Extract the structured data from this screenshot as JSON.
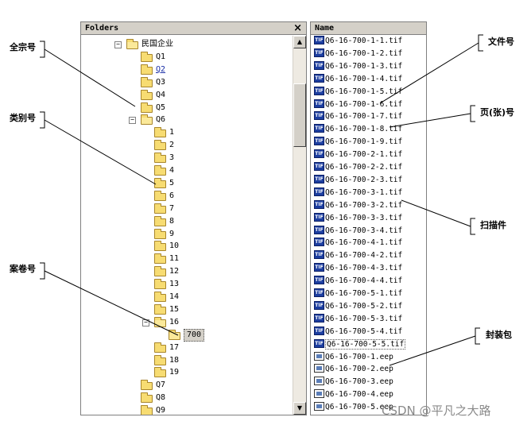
{
  "folders_pane": {
    "header": "Folders",
    "close_glyph": "×",
    "root_label": "民国企业",
    "q_items": [
      "Q1",
      "Q2",
      "Q3",
      "Q4",
      "Q5",
      "Q6"
    ],
    "q6_children": [
      "1",
      "2",
      "3",
      "4",
      "5",
      "6",
      "7",
      "8",
      "9",
      "10",
      "11",
      "12",
      "13",
      "14",
      "15",
      "16"
    ],
    "q16_child": "700",
    "after_16": [
      "17",
      "18",
      "19"
    ],
    "tail_items": [
      "Q7",
      "Q8",
      "Q9"
    ]
  },
  "files_pane": {
    "header": "Name",
    "tif_files": [
      "Q6-16-700-1-1.tif",
      "Q6-16-700-1-2.tif",
      "Q6-16-700-1-3.tif",
      "Q6-16-700-1-4.tif",
      "Q6-16-700-1-5.tif",
      "Q6-16-700-1-6.tif",
      "Q6-16-700-1-7.tif",
      "Q6-16-700-1-8.tif",
      "Q6-16-700-1-9.tif",
      "Q6-16-700-2-1.tif",
      "Q6-16-700-2-2.tif",
      "Q6-16-700-2-3.tif",
      "Q6-16-700-3-1.tif",
      "Q6-16-700-3-2.tif",
      "Q6-16-700-3-3.tif",
      "Q6-16-700-3-4.tif",
      "Q6-16-700-4-1.tif",
      "Q6-16-700-4-2.tif",
      "Q6-16-700-4-3.tif",
      "Q6-16-700-4-4.tif",
      "Q6-16-700-5-1.tif",
      "Q6-16-700-5-2.tif",
      "Q6-16-700-5-3.tif",
      "Q6-16-700-5-4.tif",
      "Q6-16-700-5-5.tif"
    ],
    "eep_files": [
      "Q6-16-700-1.eep",
      "Q6-16-700-2.eep",
      "Q6-16-700-3.eep",
      "Q6-16-700-4.eep",
      "Q6-16-700-5.eep"
    ],
    "tif_icon_text": "TIF"
  },
  "annotations": {
    "fonds": "全宗号",
    "category": "类别号",
    "volume": "案卷号",
    "file_no": "文件号",
    "page_no": "页(张)号",
    "scan": "扫描件",
    "package": "封装包"
  },
  "watermark": "CSDN @平凡之大路"
}
